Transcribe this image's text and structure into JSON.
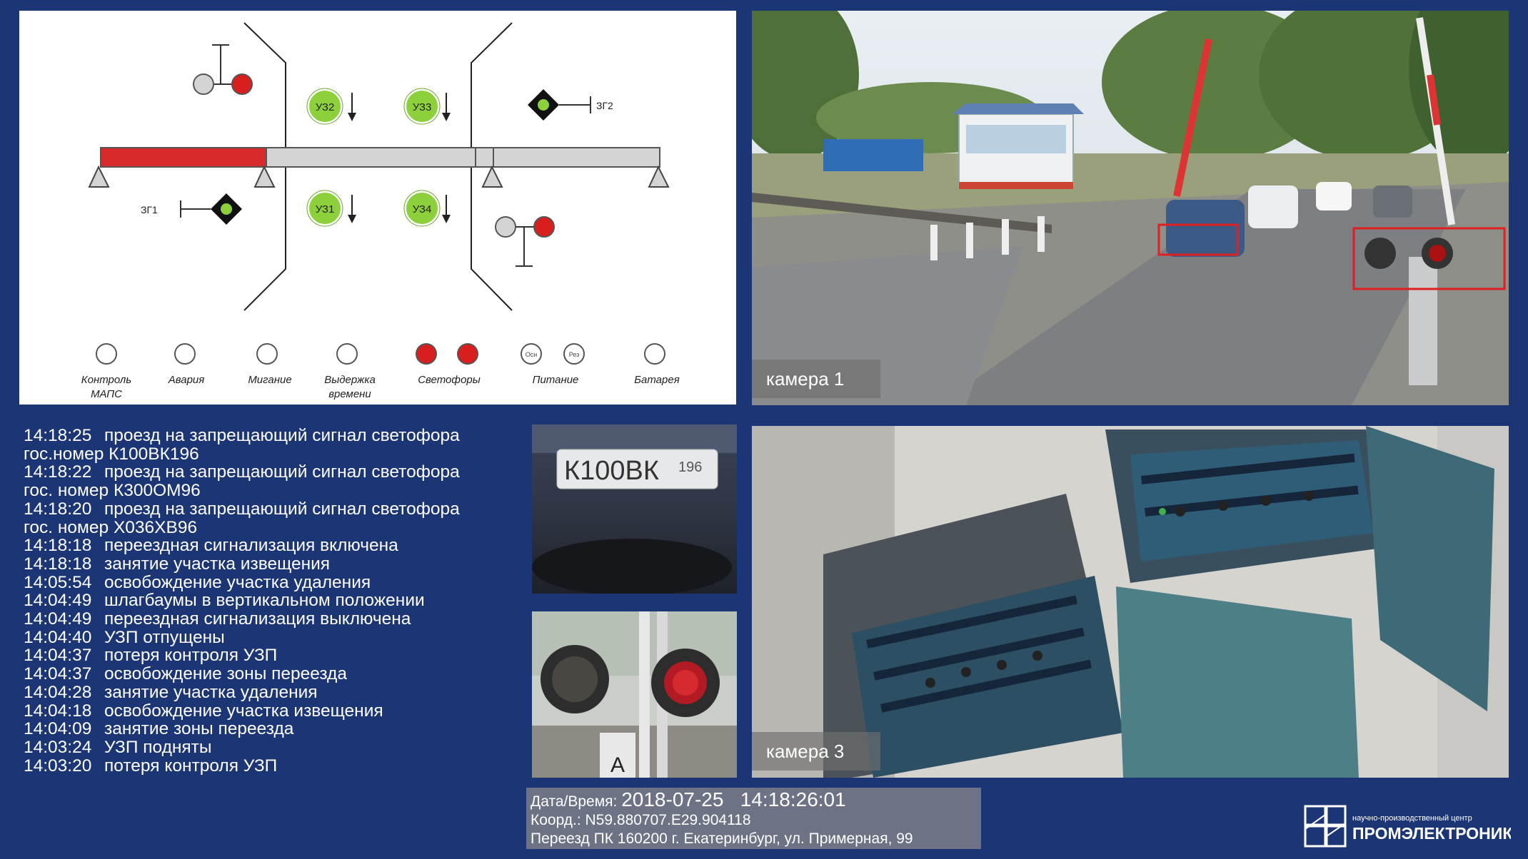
{
  "scheme": {
    "signals": {
      "zg1": "ЗГ1",
      "zg2": "ЗГ2"
    },
    "uzp": [
      "УЗ2",
      "УЗ3",
      "УЗ1",
      "УЗ4"
    ],
    "indicators": [
      {
        "label": "Контроль",
        "label2": "МАПС"
      },
      {
        "label": "Авария",
        "label2": ""
      },
      {
        "label": "Мигание",
        "label2": ""
      },
      {
        "label": "Выдержка",
        "label2": "времени"
      },
      {
        "label": "Светофоры",
        "label2": ""
      },
      {
        "label": "Питание",
        "label2": ""
      },
      {
        "label": "Батарея",
        "label2": ""
      }
    ],
    "power_small": [
      "Осн",
      "Рез"
    ],
    "colors": {
      "occupied": "#d82a2a",
      "free": "#d4d4d4",
      "uzp": "#8cd13b",
      "signal_red": "#d91e1e"
    }
  },
  "cameras": {
    "cam1_label": "камера 1",
    "cam3_label": "камера 3"
  },
  "plate_text": "К100ВК",
  "plate_region": "196",
  "events": [
    {
      "time": "14:18:25",
      "msg": "проезд на запрещающий сигнал светофора",
      "sub": "гос.номер К100ВК196"
    },
    {
      "time": "14:18:22",
      "msg": "проезд на запрещающий сигнал светофора",
      "sub": "гос. номер К300ОМ96"
    },
    {
      "time": "14:18:20",
      "msg": "проезд на запрещающий сигнал светофора",
      "sub": "гос. номер Х036ХВ96"
    },
    {
      "time": "14:18:18",
      "msg": "переездная сигнализация включена",
      "sub": ""
    },
    {
      "time": "14:18:18",
      "msg": "занятие участка извещения",
      "sub": ""
    },
    {
      "time": "14:05:54",
      "msg": "освобождение участка удаления",
      "sub": ""
    },
    {
      "time": "14:04:49",
      "msg": "шлагбаумы в вертикальном положении",
      "sub": ""
    },
    {
      "time": "14:04:49",
      "msg": "переездная сигнализация выключена",
      "sub": ""
    },
    {
      "time": "14:04:40",
      "msg": "УЗП отпущены",
      "sub": ""
    },
    {
      "time": "14:04:37",
      "msg": "потеря контроля УЗП",
      "sub": ""
    },
    {
      "time": "14:04:37",
      "msg": "освобождение зоны переезда",
      "sub": ""
    },
    {
      "time": "14:04:28",
      "msg": "занятие участка удаления",
      "sub": ""
    },
    {
      "time": "14:04:18",
      "msg": "освобождение участка извещения",
      "sub": ""
    },
    {
      "time": "14:04:09",
      "msg": "занятие зоны переезда",
      "sub": ""
    },
    {
      "time": "14:03:24",
      "msg": "УЗП подняты",
      "sub": ""
    },
    {
      "time": "14:03:20",
      "msg": "потеря контроля УЗП",
      "sub": ""
    }
  ],
  "info": {
    "datetime_label": "Дата/Время:",
    "datetime_value": "2018-07-25   14:18:26:01",
    "coords": "Коорд.: N59.880707.E29.904118",
    "crossing": "Переезд ПК 160200 г. Екатеринбург, ул. Примерная, 99"
  },
  "logo": {
    "line1": "научно-производственный центр",
    "line2": "ПРОМЭЛЕКТРОНИКА"
  }
}
